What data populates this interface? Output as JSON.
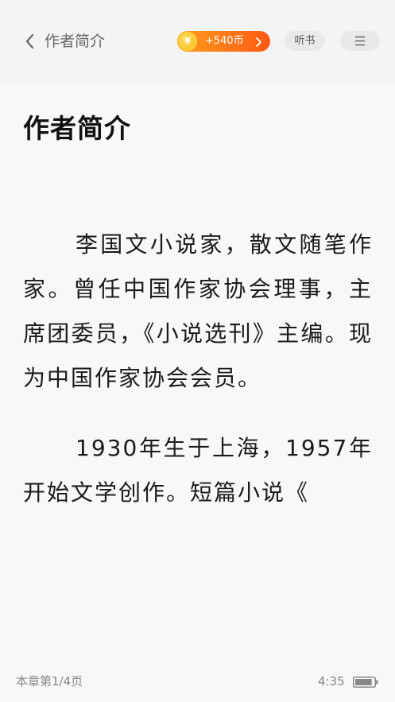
{
  "header": {
    "title": "作者简介",
    "coin_badge": "+540币",
    "coin_symbol": "¥",
    "listen_label": "听书"
  },
  "chapter": {
    "title": "作者简介",
    "paragraphs": [
      "李国文小说家，散文随笔作家。曾任中国作家协会理事，主席团委员，《小说选刊》主编。现为中国作家协会会员。",
      "1930年生于上海，1957年开始文学创作。短篇小说《"
    ]
  },
  "footer": {
    "progress": "本章第1/4页",
    "time": "4:35",
    "battery_level": 0.9
  },
  "colors": {
    "accent": "#ff7a18",
    "background": "#f8f8f8"
  },
  "icons": [
    "back-arrow-icon",
    "coin-icon",
    "chevron-right-icon",
    "menu-icon",
    "battery-icon"
  ]
}
